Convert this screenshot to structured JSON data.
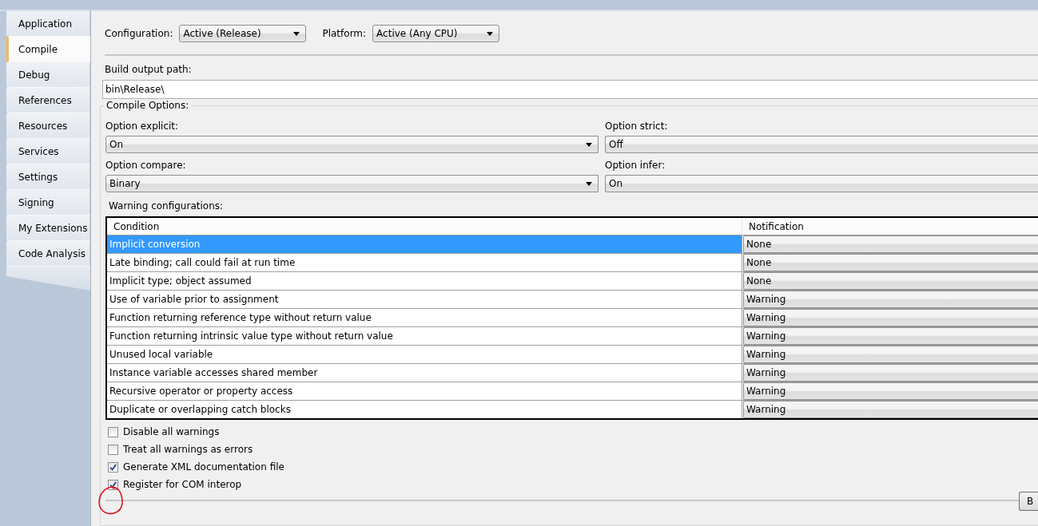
{
  "tabs": [
    {
      "label": "Application",
      "selected": false
    },
    {
      "label": "Compile",
      "selected": true
    },
    {
      "label": "Debug",
      "selected": false
    },
    {
      "label": "References",
      "selected": false
    },
    {
      "label": "Resources",
      "selected": false
    },
    {
      "label": "Services",
      "selected": false
    },
    {
      "label": "Settings",
      "selected": false
    },
    {
      "label": "Signing",
      "selected": false
    },
    {
      "label": "My Extensions",
      "selected": false
    },
    {
      "label": "Code Analysis",
      "selected": false
    }
  ],
  "configuration": {
    "label": "Configuration:",
    "value": "Active (Release)"
  },
  "platform": {
    "label": "Platform:",
    "value": "Active (Any CPU)"
  },
  "build_output_path": {
    "label": "Build output path:",
    "value": "bin\\Release\\"
  },
  "compile_options": {
    "title": "Compile Options:",
    "options": [
      {
        "label": "Option explicit:",
        "value": "On"
      },
      {
        "label": "Option strict:",
        "value": "Off"
      },
      {
        "label": "Option compare:",
        "value": "Binary"
      },
      {
        "label": "Option infer:",
        "value": "On"
      }
    ],
    "warning_label": "Warning configurations:",
    "table": {
      "columns": [
        "Condition",
        "Notification"
      ],
      "rows": [
        {
          "condition": "Implicit conversion",
          "notification": "None",
          "selected": true
        },
        {
          "condition": "Late binding; call could fail at run time",
          "notification": "None",
          "selected": false
        },
        {
          "condition": "Implicit type; object assumed",
          "notification": "None",
          "selected": false
        },
        {
          "condition": "Use of variable prior to assignment",
          "notification": "Warning",
          "selected": false
        },
        {
          "condition": "Function returning reference type without return value",
          "notification": "Warning",
          "selected": false
        },
        {
          "condition": "Function returning intrinsic value type without return value",
          "notification": "Warning",
          "selected": false
        },
        {
          "condition": "Unused local variable",
          "notification": "Warning",
          "selected": false
        },
        {
          "condition": "Instance variable accesses shared member",
          "notification": "Warning",
          "selected": false
        },
        {
          "condition": "Recursive operator or property access",
          "notification": "Warning",
          "selected": false
        },
        {
          "condition": "Duplicate or overlapping catch blocks",
          "notification": "Warning",
          "selected": false
        }
      ]
    },
    "checkboxes": [
      {
        "label": "Disable all warnings",
        "checked": false
      },
      {
        "label": "Treat all warnings as errors",
        "checked": false
      },
      {
        "label": "Generate XML documentation file",
        "checked": true
      },
      {
        "label": "Register for COM interop",
        "checked": true
      }
    ],
    "button": "B"
  }
}
